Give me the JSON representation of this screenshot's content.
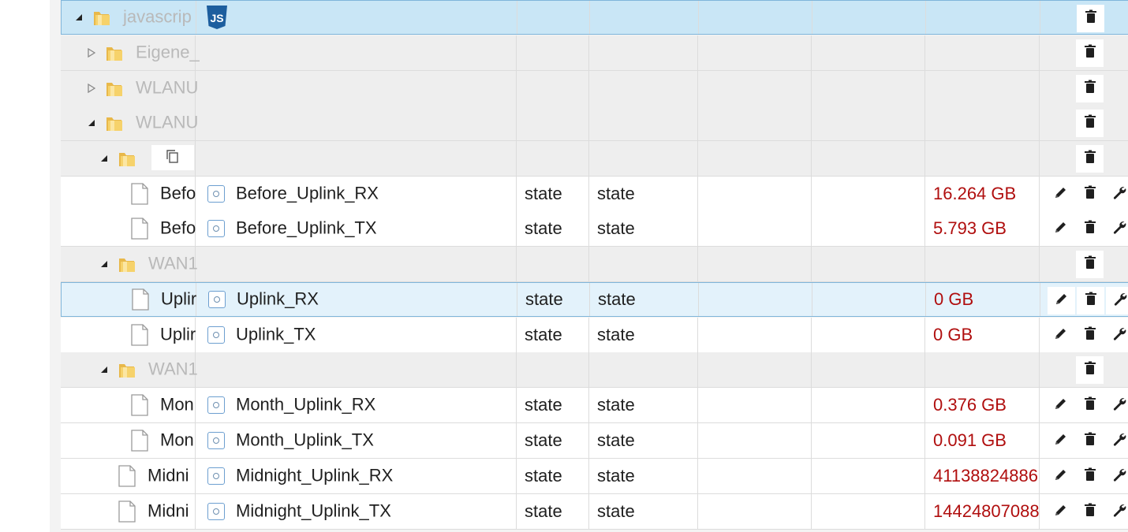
{
  "rows": [
    {
      "kind": "folder",
      "name": "javascrip",
      "expanded": true,
      "selected": true,
      "has_js_icon": true
    },
    {
      "kind": "folder",
      "name": "Eigene_",
      "expanded": false
    },
    {
      "kind": "folder",
      "name": "WLANU",
      "expanded": false
    },
    {
      "kind": "folder",
      "name": "WLANU",
      "expanded": true
    },
    {
      "kind": "folder",
      "name": "",
      "expanded": true,
      "has_copy_button": true
    },
    {
      "kind": "object",
      "name": "Befo",
      "id": "Before_Uplink_RX",
      "type": "state",
      "role": "state",
      "value": "16.264 GB"
    },
    {
      "kind": "object",
      "name": "Befo",
      "id": "Before_Uplink_TX",
      "type": "state",
      "role": "state",
      "value": "5.793 GB"
    },
    {
      "kind": "folder",
      "name": "WAN1",
      "expanded": true
    },
    {
      "kind": "object",
      "name": "Uplir",
      "id": "Uplink_RX",
      "type": "state",
      "role": "state",
      "value": "0 GB",
      "selected": true
    },
    {
      "kind": "object",
      "name": "Uplir",
      "id": "Uplink_TX",
      "type": "state",
      "role": "state",
      "value": "0 GB"
    },
    {
      "kind": "folder",
      "name": "WAN1",
      "expanded": true
    },
    {
      "kind": "object",
      "name": "Mon",
      "id": "Month_Uplink_RX",
      "type": "state",
      "role": "state",
      "value": "0.376 GB"
    },
    {
      "kind": "object",
      "name": "Mon",
      "id": "Month_Uplink_TX",
      "type": "state",
      "role": "state",
      "value": "0.091 GB"
    },
    {
      "kind": "object",
      "name": "Midni",
      "id": "Midnight_Uplink_RX",
      "type": "state",
      "role": "state",
      "value": "41138824886"
    },
    {
      "kind": "object",
      "name": "Midni",
      "id": "Midnight_Uplink_TX",
      "type": "state",
      "role": "state",
      "value": "14424807088"
    }
  ],
  "icons": {
    "folder": "folder-icon",
    "object": "file-icon",
    "js": "javascript-icon",
    "copy": "copy-icon",
    "id": "state-id-icon",
    "edit": "pencil-icon",
    "delete": "trash-icon",
    "settings": "wrench-icon"
  },
  "colors": {
    "value_red": "#b00e0e",
    "selection_blue": "#c9e6f6",
    "folder_yellow": "#f2c94c"
  }
}
